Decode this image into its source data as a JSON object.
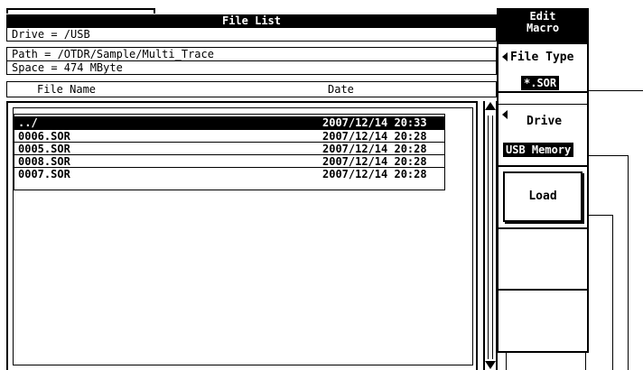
{
  "file_list": {
    "title": "File List",
    "drive_line": "Drive = /USB",
    "path_line": "Path = /OTDR/Sample/Multi_Trace",
    "space_line": "Space = 474 MByte",
    "columns": {
      "name": "File Name",
      "date": "Date"
    },
    "rows": [
      {
        "name": "../",
        "date": "2007/12/14 20:33",
        "selected": true
      },
      {
        "name": "0006.SOR",
        "date": "2007/12/14 20:28"
      },
      {
        "name": "0005.SOR",
        "date": "2007/12/14 20:28"
      },
      {
        "name": "0008.SOR",
        "date": "2007/12/14 20:28"
      },
      {
        "name": "0007.SOR",
        "date": "2007/12/14 20:28"
      }
    ]
  },
  "softkeys": {
    "edit_macro": [
      "Edit",
      "Macro"
    ],
    "file_type": {
      "label": "File Type",
      "value": "*.SOR"
    },
    "drive": {
      "label": "Drive",
      "value": "USB Memory"
    },
    "load": "Load"
  },
  "icons": {
    "scroll_up": "up-triangle",
    "scroll_down": "down-triangle",
    "softkey_arrow": "left-triangle"
  }
}
